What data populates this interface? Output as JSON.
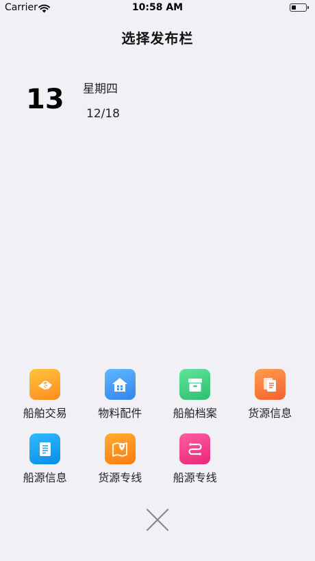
{
  "status_bar": {
    "carrier": "Carrier",
    "time": "10:58 AM",
    "battery_level": 0.3
  },
  "header": {
    "title": "选择发布栏"
  },
  "date": {
    "day": "13",
    "weekday": "星期四",
    "month_day": "12/18"
  },
  "menu": {
    "rows": [
      [
        {
          "label": "船舶交易",
          "icon": "handshake-icon",
          "color_from": "#ffc53d",
          "color_to": "#ff8a1f"
        },
        {
          "label": "物料配件",
          "icon": "house-icon",
          "color_from": "#64b6ff",
          "color_to": "#2f86f0"
        },
        {
          "label": "船舶档案",
          "icon": "archive-box-icon",
          "color_from": "#62e39a",
          "color_to": "#2bc070"
        },
        {
          "label": "货源信息",
          "icon": "documents-icon",
          "color_from": "#ff9d4f",
          "color_to": "#f4622e"
        }
      ],
      [
        {
          "label": "船源信息",
          "icon": "document-list-icon",
          "color_from": "#33b7ff",
          "color_to": "#078fe6"
        },
        {
          "label": "货源专线",
          "icon": "map-pin-icon",
          "color_from": "#ffad2e",
          "color_to": "#ff7a12"
        },
        {
          "label": "船源专线",
          "icon": "route-icon",
          "color_from": "#ff5ea0",
          "color_to": "#e8267a"
        }
      ]
    ]
  },
  "close": {
    "icon": "close-icon",
    "color": "#8a8a8a"
  }
}
